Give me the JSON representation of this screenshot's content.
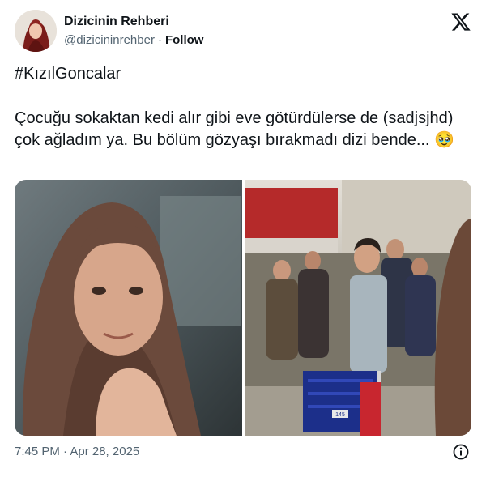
{
  "author": {
    "name": "Dizicinin Rehberi",
    "handle": "@dizicininrehber",
    "separator": "·",
    "follow_label": "Follow"
  },
  "tweet": {
    "hashtag": "#KızılGoncalar",
    "body": "Çocuğu sokaktan kedi alır gibi eve götürdülerse de (sadjsjhd) çok ağladım ya. Bu bölüm gözyaşı bırakmadı dizi bende... 🥹",
    "timestamp": "7:45 PM · Apr 28, 2025"
  },
  "media": {
    "crate_label": "145"
  },
  "icons": {
    "logo": "x-logo-icon",
    "info": "info-icon"
  },
  "colors": {
    "text": "#0f1419",
    "secondary": "#536471",
    "background": "#ffffff"
  }
}
